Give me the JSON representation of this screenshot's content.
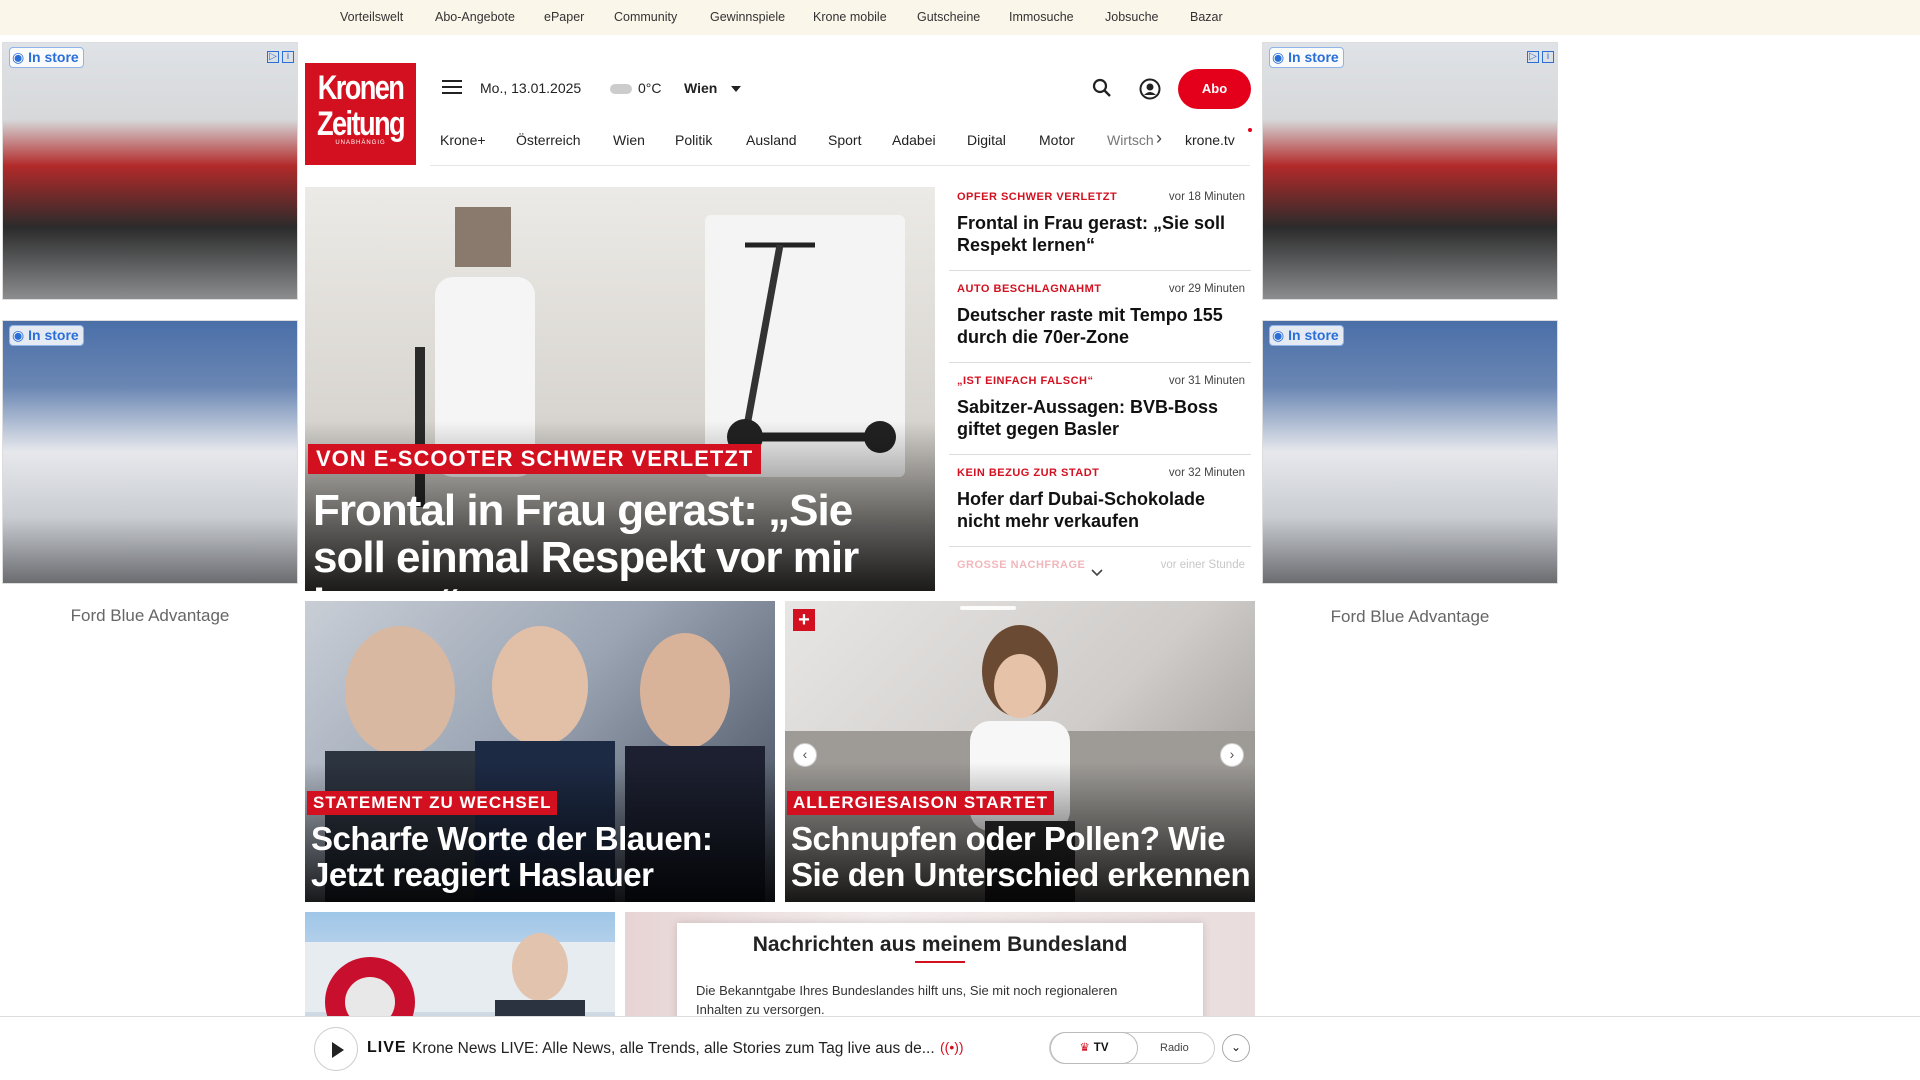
{
  "topnav": [
    "Vorteilswelt",
    "Abo-Angebote",
    "ePaper",
    "Community",
    "Gewinnspiele",
    "Krone mobile",
    "Gutscheine",
    "Immosuche",
    "Jobsuche",
    "Bazar"
  ],
  "ads": {
    "badge": "In store",
    "brand": "Ford Blue Advantage",
    "adchoices": "▷"
  },
  "header": {
    "logo_line1": "Kronen",
    "logo_line2": "Zeitung",
    "logo_line3": "UNABHÄNGIG",
    "date": "Mo., 13.01.2025",
    "temperature": "0°C",
    "city": "Wien",
    "abo_label": "Abo"
  },
  "nav": [
    "Krone+",
    "Österreich",
    "Wien",
    "Politik",
    "Ausland",
    "Sport",
    "Adabei",
    "Digital",
    "Motor",
    "Wirtsch",
    "krone.tv"
  ],
  "hero": {
    "kicker": "VON E-SCOOTER SCHWER VERLETZT",
    "title": "Frontal in Frau gerast: „Sie soll einmal Respekt vor mir lernen“"
  },
  "headlines": [
    {
      "kicker": "OPFER SCHWER VERLETZT",
      "time": "vor 18 Minuten",
      "title": "Frontal in Frau gerast: „Sie soll Respekt lernen“"
    },
    {
      "kicker": "AUTO BESCHLAGNAHMT",
      "time": "vor 29 Minuten",
      "title": "Deutscher raste mit Tempo 155 durch die 70er-Zone"
    },
    {
      "kicker": "„IST EINFACH FALSCH“",
      "time": "vor 31 Minuten",
      "title": "Sabitzer-Aussagen: BVB-Boss giftet gegen Basler"
    },
    {
      "kicker": "KEIN BEZUG ZUR STADT",
      "time": "vor 32 Minuten",
      "title": "Hofer darf Dubai-Schokolade nicht mehr verkaufen"
    },
    {
      "kicker": "GROSSE NACHFRAGE",
      "time": "vor einer Stunde",
      "title": ""
    }
  ],
  "teasers": [
    {
      "kicker": "STATEMENT ZU WECHSEL",
      "title": "Scharfe Worte der Blauen: Jetzt reagiert Haslauer"
    },
    {
      "kicker": "ALLERGIESAISON STARTET",
      "title": "Schnupfen oder Pollen? Wie Sie den Unterschied erkennen"
    }
  ],
  "bundesland": {
    "title": "Nachrichten aus meinem Bundesland",
    "body": "Die Bekanntgabe Ihres Bundeslandes hilft uns, Sie mit noch regionaleren Inhalten zu versorgen."
  },
  "live": {
    "label": "LIVE",
    "text": "Krone News LIVE: Alle News, alle Trends, alle Stories zum Tag live aus de...",
    "tv_label": "TV",
    "radio_label": "Radio"
  }
}
